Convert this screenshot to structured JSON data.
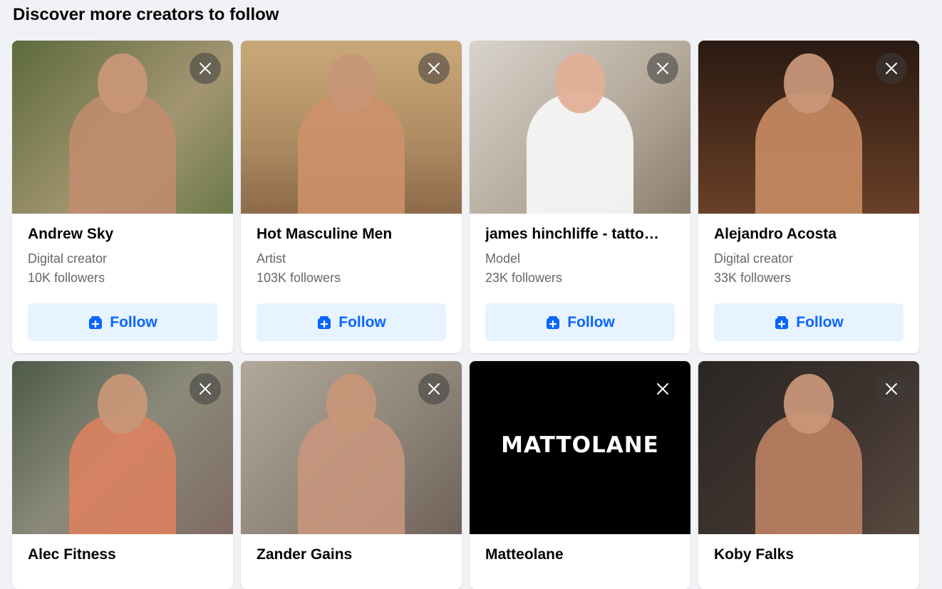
{
  "section": {
    "title": "Discover more creators to follow"
  },
  "cards": [
    {
      "name": "Andrew Sky",
      "category": "Digital creator",
      "followers": "10K followers",
      "follow_label": "Follow",
      "photo_colors": [
        "#5d6b3d",
        "#a39572"
      ]
    },
    {
      "name": "Hot Masculine Men",
      "category": "Artist",
      "followers": "103K followers",
      "follow_label": "Follow",
      "photo_colors": [
        "#c9a878",
        "#8d6a4a"
      ]
    },
    {
      "name": "james hinchliffe - tatto…",
      "category": "Model",
      "followers": "23K followers",
      "follow_label": "Follow",
      "photo_colors": [
        "#d8d3cb",
        "#8b7d6c"
      ]
    },
    {
      "name": "Alejandro Acosta",
      "category": "Digital creator",
      "followers": "33K followers",
      "follow_label": "Follow",
      "photo_colors": [
        "#3a2418",
        "#6a4028"
      ]
    },
    {
      "name": "Alec Fitness",
      "photo_colors": [
        "#4e5a48",
        "#7f6b62"
      ]
    },
    {
      "name": "Zander Gains",
      "photo_colors": [
        "#b1a89a",
        "#6f625a"
      ]
    },
    {
      "name": "Matteolane",
      "photo_text": "MATTOLANE",
      "photo_colors": [
        "#000000",
        "#000000"
      ]
    },
    {
      "name": "Koby Falks",
      "photo_colors": [
        "#2a2624",
        "#5a4a40"
      ]
    }
  ],
  "icons": {
    "close": "close-icon",
    "follow": "add-friend-icon"
  },
  "colors": {
    "accent": "#0866ff",
    "button_bg": "#e7f3ff",
    "secondary_text": "#65676b",
    "page_bg": "#f0f2f5"
  }
}
